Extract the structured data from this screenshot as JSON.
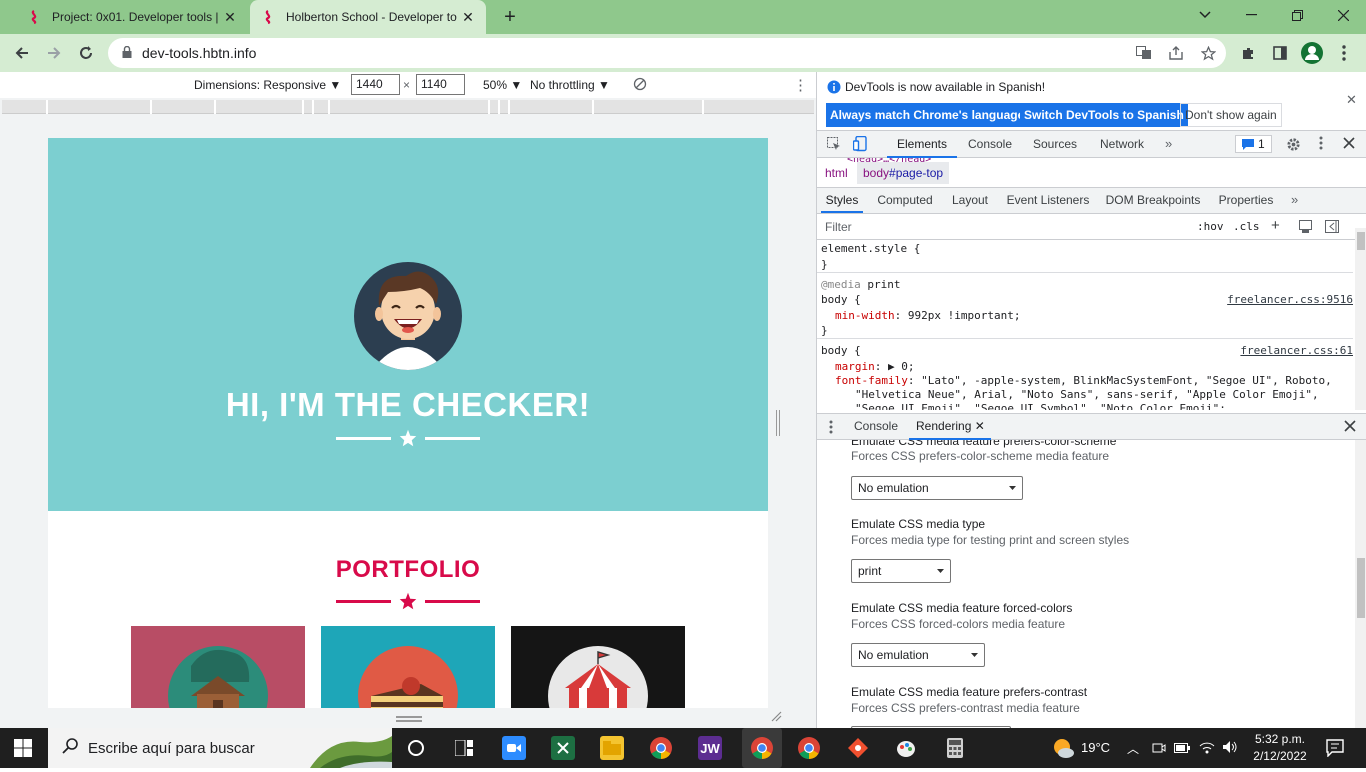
{
  "browser": {
    "tabs": [
      {
        "title": "Project: 0x01. Developer tools | H",
        "close": "✕"
      },
      {
        "title": "Holberton School - Developer to",
        "close": "✕"
      }
    ],
    "new_tab": "+",
    "url": "dev-tools.hbtn.info"
  },
  "device_toolbar": {
    "dimensions": "Dimensions: Responsive ▼",
    "width": "1440",
    "times": "×",
    "height": "1140",
    "zoom": "50% ▼",
    "throttling": "No throttling ▼",
    "more": "⋮"
  },
  "page": {
    "hero_title": "HI, I'M THE CHECKER!",
    "portfolio_title": "PORTFOLIO",
    "colors": {
      "hero": "#7ccfd0",
      "accent": "#d80a4a"
    }
  },
  "devtools": {
    "infobar": {
      "message": "DevTools is now available in Spanish!",
      "btn_match": "Always match Chrome's language",
      "btn_switch": "Switch DevTools to Spanish",
      "btn_dismiss": "Don't show again"
    },
    "main_tabs": [
      "Elements",
      "Console",
      "Sources",
      "Network"
    ],
    "issues_count": "1",
    "breadcrumb": {
      "html": "html",
      "body_tag": "body",
      "body_id": "#page-top"
    },
    "style_tabs": [
      "Styles",
      "Computed",
      "Layout",
      "Event Listeners",
      "DOM Breakpoints",
      "Properties"
    ],
    "filter_placeholder": "Filter",
    "hov": ":hov",
    "cls": ".cls",
    "rules": {
      "element_style": "element.style {",
      "close": "}",
      "media_kw": "@media",
      "media_val": " print",
      "body_sel": "body {",
      "src1": "freelancer.css:9516",
      "min_width_prop": "min-width",
      "min_width_val": ": 992px !important;",
      "src2": "freelancer.css:61",
      "margin_prop": "margin",
      "margin_val": ": ▶ 0;",
      "ff_prop": "font-family",
      "ff_val1": ": \"Lato\", -apple-system, BlinkMacSystemFont, \"Segoe UI\", Roboto,",
      "ff_val2": "\"Helvetica Neue\", Arial, \"Noto Sans\", sans-serif, \"Apple Color Emoji\",",
      "ff_val3": "\"Segoe UI Emoji\", \"Segoe UI Symbol\", \"Noto Color Emoji\";"
    },
    "drawer_tabs": [
      "Console",
      "Rendering"
    ],
    "rendering": [
      {
        "title": "Emulate CSS media feature prefers-color-scheme",
        "desc": "Forces CSS prefers-color-scheme media feature",
        "value": "No emulation"
      },
      {
        "title": "Emulate CSS media type",
        "desc": "Forces media type for testing print and screen styles",
        "value": "print"
      },
      {
        "title": "Emulate CSS media feature forced-colors",
        "desc": "Forces CSS forced-colors media feature",
        "value": "No emulation"
      },
      {
        "title": "Emulate CSS media feature prefers-contrast",
        "desc": "Forces CSS prefers-contrast media feature",
        "value": ""
      }
    ]
  },
  "taskbar": {
    "search_placeholder": "Escribe aquí para buscar",
    "weather": "19°C",
    "time": "5:32 p.m.",
    "date": "2/12/2022",
    "jw_label": "JW"
  }
}
